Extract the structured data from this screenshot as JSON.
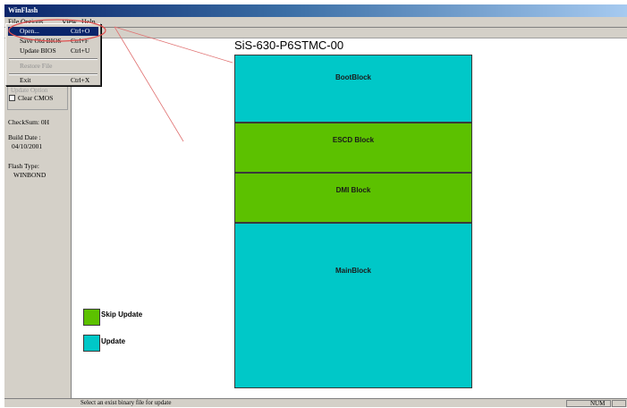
{
  "window": {
    "title": "WinFlash"
  },
  "menubar": {
    "file": "File",
    "options": "Options...",
    "view": "View",
    "help": "Help"
  },
  "file_menu": {
    "items": [
      {
        "label": "Open...",
        "shortcut": "Ctrl+O",
        "state": "highlighted"
      },
      {
        "label": "Save Old BIOS",
        "shortcut": "Ctrl+F"
      },
      {
        "label": "Update BIOS",
        "shortcut": "Ctrl+U"
      },
      {
        "label": "Restore File",
        "shortcut": "",
        "state": "disabled"
      },
      {
        "label": "Exit",
        "shortcut": "Ctrl+X"
      }
    ]
  },
  "left_panel": {
    "group_label": "Update Option",
    "clear_cmos": "Clear CMOS",
    "checksum": "CheckSum: 0H",
    "build_date_label": "Build Date :",
    "build_date": "04/10/2001",
    "flash_type_label": "Flash Type:",
    "flash_type": "WINBOND"
  },
  "chart": {
    "title": "SiS-630-P6STMC-00",
    "blocks": [
      {
        "label": "BootBlock",
        "status": "update",
        "height_fraction": 0.2
      },
      {
        "label": "ESCD Block",
        "status": "skip",
        "height_fraction": 0.15
      },
      {
        "label": "DMI Block",
        "status": "skip",
        "height_fraction": 0.15
      },
      {
        "label": "MainBlock",
        "status": "update",
        "height_fraction": 0.5
      }
    ],
    "colors": {
      "update": "#00c8c8",
      "skip": "#5cc100"
    }
  },
  "legend": {
    "skip": "Skip Update",
    "update": "Update"
  },
  "status": {
    "text": "Select an exist binary file for update",
    "num": "NUM"
  }
}
